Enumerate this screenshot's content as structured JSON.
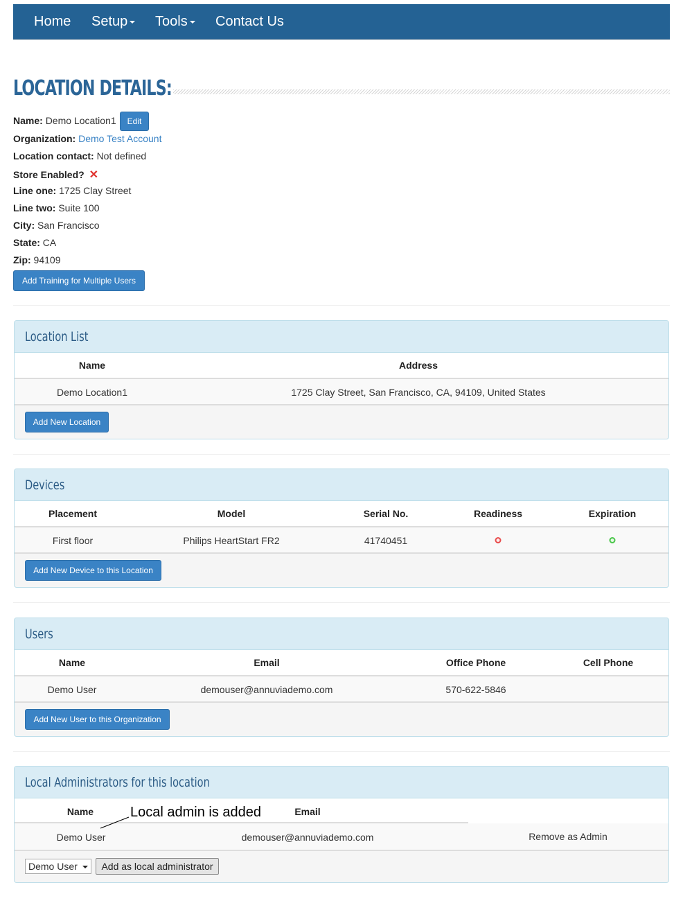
{
  "nav": {
    "home": "Home",
    "setup": "Setup",
    "tools": "Tools",
    "contact": "Contact Us"
  },
  "page_title": "LOCATION DETAILS:",
  "details": {
    "name_label": "Name:",
    "name_value": "Demo Location1",
    "edit_label": "Edit",
    "org_label": "Organization:",
    "org_value": "Demo Test Account",
    "contact_label": "Location contact:",
    "contact_value": "Not defined",
    "store_label": "Store Enabled?",
    "store_value": "✕",
    "line1_label": "Line one:",
    "line1_value": "1725 Clay Street",
    "line2_label": "Line two:",
    "line2_value": "Suite 100",
    "city_label": "City:",
    "city_value": "San Francisco",
    "state_label": "State:",
    "state_value": "CA",
    "zip_label": "Zip:",
    "zip_value": "94109",
    "add_training_label": "Add Training for Multiple Users"
  },
  "location_list": {
    "title": "Location List",
    "headers": [
      "Name",
      "Address"
    ],
    "rows": [
      [
        "Demo Location1",
        "1725 Clay Street, San Francisco, CA, 94109, United States"
      ]
    ],
    "add_label": "Add New Location"
  },
  "devices": {
    "title": "Devices",
    "headers": [
      "Placement",
      "Model",
      "Serial No.",
      "Readiness",
      "Expiration"
    ],
    "rows": [
      {
        "placement": "First floor",
        "model": "Philips HeartStart FR2",
        "serial": "41740451",
        "readiness": "red",
        "expiration": "green"
      }
    ],
    "add_label": "Add New Device to this Location"
  },
  "users": {
    "title": "Users",
    "headers": [
      "Name",
      "Email",
      "Office Phone",
      "Cell Phone"
    ],
    "rows": [
      [
        "Demo User",
        "demouser@annuviademo.com",
        "570-622-5846",
        ""
      ]
    ],
    "add_label": "Add New User to this Organization"
  },
  "admins": {
    "title": "Local Administrators for this location",
    "headers": [
      "Name",
      "Email"
    ],
    "rows": [
      [
        "Demo User",
        "demouser@annuviademo.com",
        "Remove as Admin"
      ]
    ],
    "select_value": "Demo User",
    "add_label": "Add as local administrator"
  },
  "annotation": "Local admin is added",
  "colors": {
    "red_status": "#e84c4c",
    "green_status": "#49c649",
    "accent": "#3a83c5",
    "navbar": "#246294"
  }
}
